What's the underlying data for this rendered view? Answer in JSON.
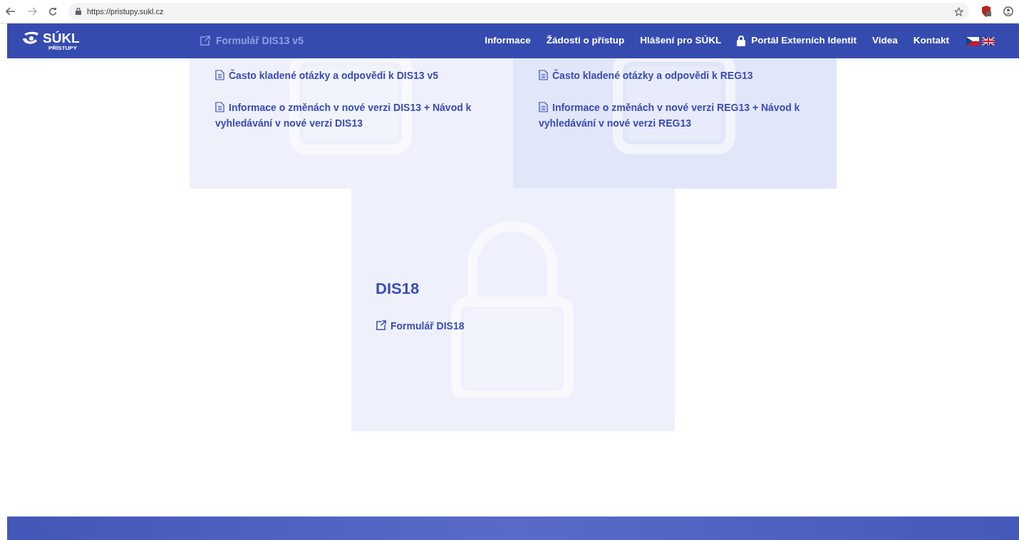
{
  "browser": {
    "url": "https://pristupy.sukl.cz"
  },
  "header": {
    "logo": {
      "name": "SÚKL",
      "subtitle": "PŘÍSTUPY"
    },
    "underlying_link": {
      "label": "Formulář DIS13 v5",
      "kind": "external"
    },
    "nav": [
      {
        "label": "Informace",
        "kind": "plain"
      },
      {
        "label": "Žádosti o přístup",
        "kind": "plain"
      },
      {
        "label": "Hlášení pro SÚKL",
        "kind": "plain"
      },
      {
        "label": "Portál Externích Identit",
        "kind": "lock"
      },
      {
        "label": "Videa",
        "kind": "plain"
      },
      {
        "label": "Kontakt",
        "kind": "plain"
      }
    ]
  },
  "sections": [
    {
      "color": "#eef1fc",
      "links": [
        {
          "label": "Často kladené otázky a odpovědi k DIS13 v5",
          "kind": "document"
        },
        {
          "label": "Informace o změnách v nové verzi DIS13 + Návod k vyhledávání v nové verzi DIS13",
          "kind": "document"
        }
      ]
    },
    {
      "color": "#e1e6f9",
      "links": [
        {
          "label": "Často kladené otázky a odpovědi k REG13",
          "kind": "document"
        },
        {
          "label": "Informace o změnách v nové verzi REG13 + Návod k vyhledávání v nové verzi REG13",
          "kind": "document"
        }
      ]
    },
    {
      "color": "#eef1fc",
      "title": "DIS18",
      "links": [
        {
          "label": "Formulář DIS18",
          "kind": "external"
        }
      ]
    }
  ]
}
